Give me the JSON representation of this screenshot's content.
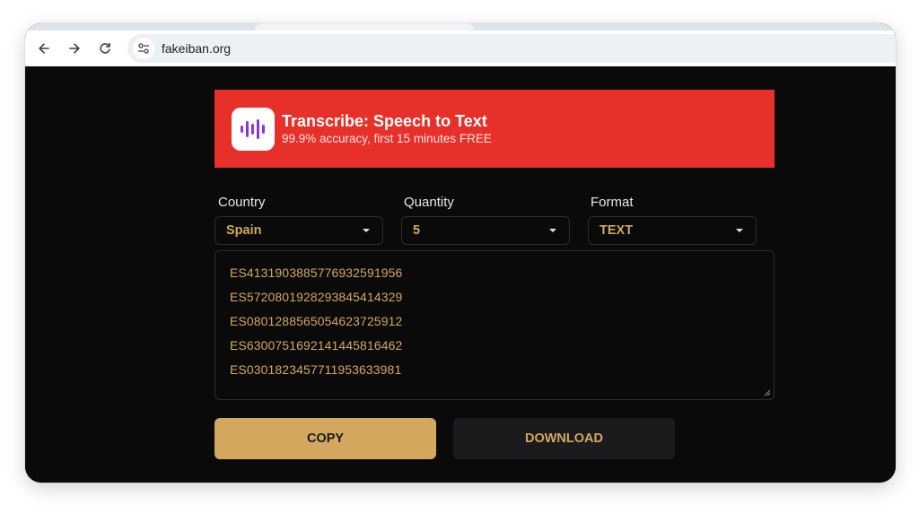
{
  "browser": {
    "url": "fakeiban.org"
  },
  "banner": {
    "title": "Transcribe: Speech to Text",
    "subtitle": "99.9% accuracy, first 15 minutes FREE",
    "color": "#e8302a"
  },
  "form": {
    "country": {
      "label": "Country",
      "value": "Spain"
    },
    "quantity": {
      "label": "Quantity",
      "value": "5"
    },
    "format": {
      "label": "Format",
      "value": "TEXT"
    }
  },
  "results": [
    "ES4131903885776932591956",
    "ES5720801928293845414329",
    "ES0801288565054623725912",
    "ES6300751692141445816462",
    "ES0301823457711953633981"
  ],
  "actions": {
    "copy_label": "COPY",
    "download_label": "DOWNLOAD"
  },
  "colors": {
    "accent": "#d3a75e",
    "background": "#0a0a0a"
  }
}
